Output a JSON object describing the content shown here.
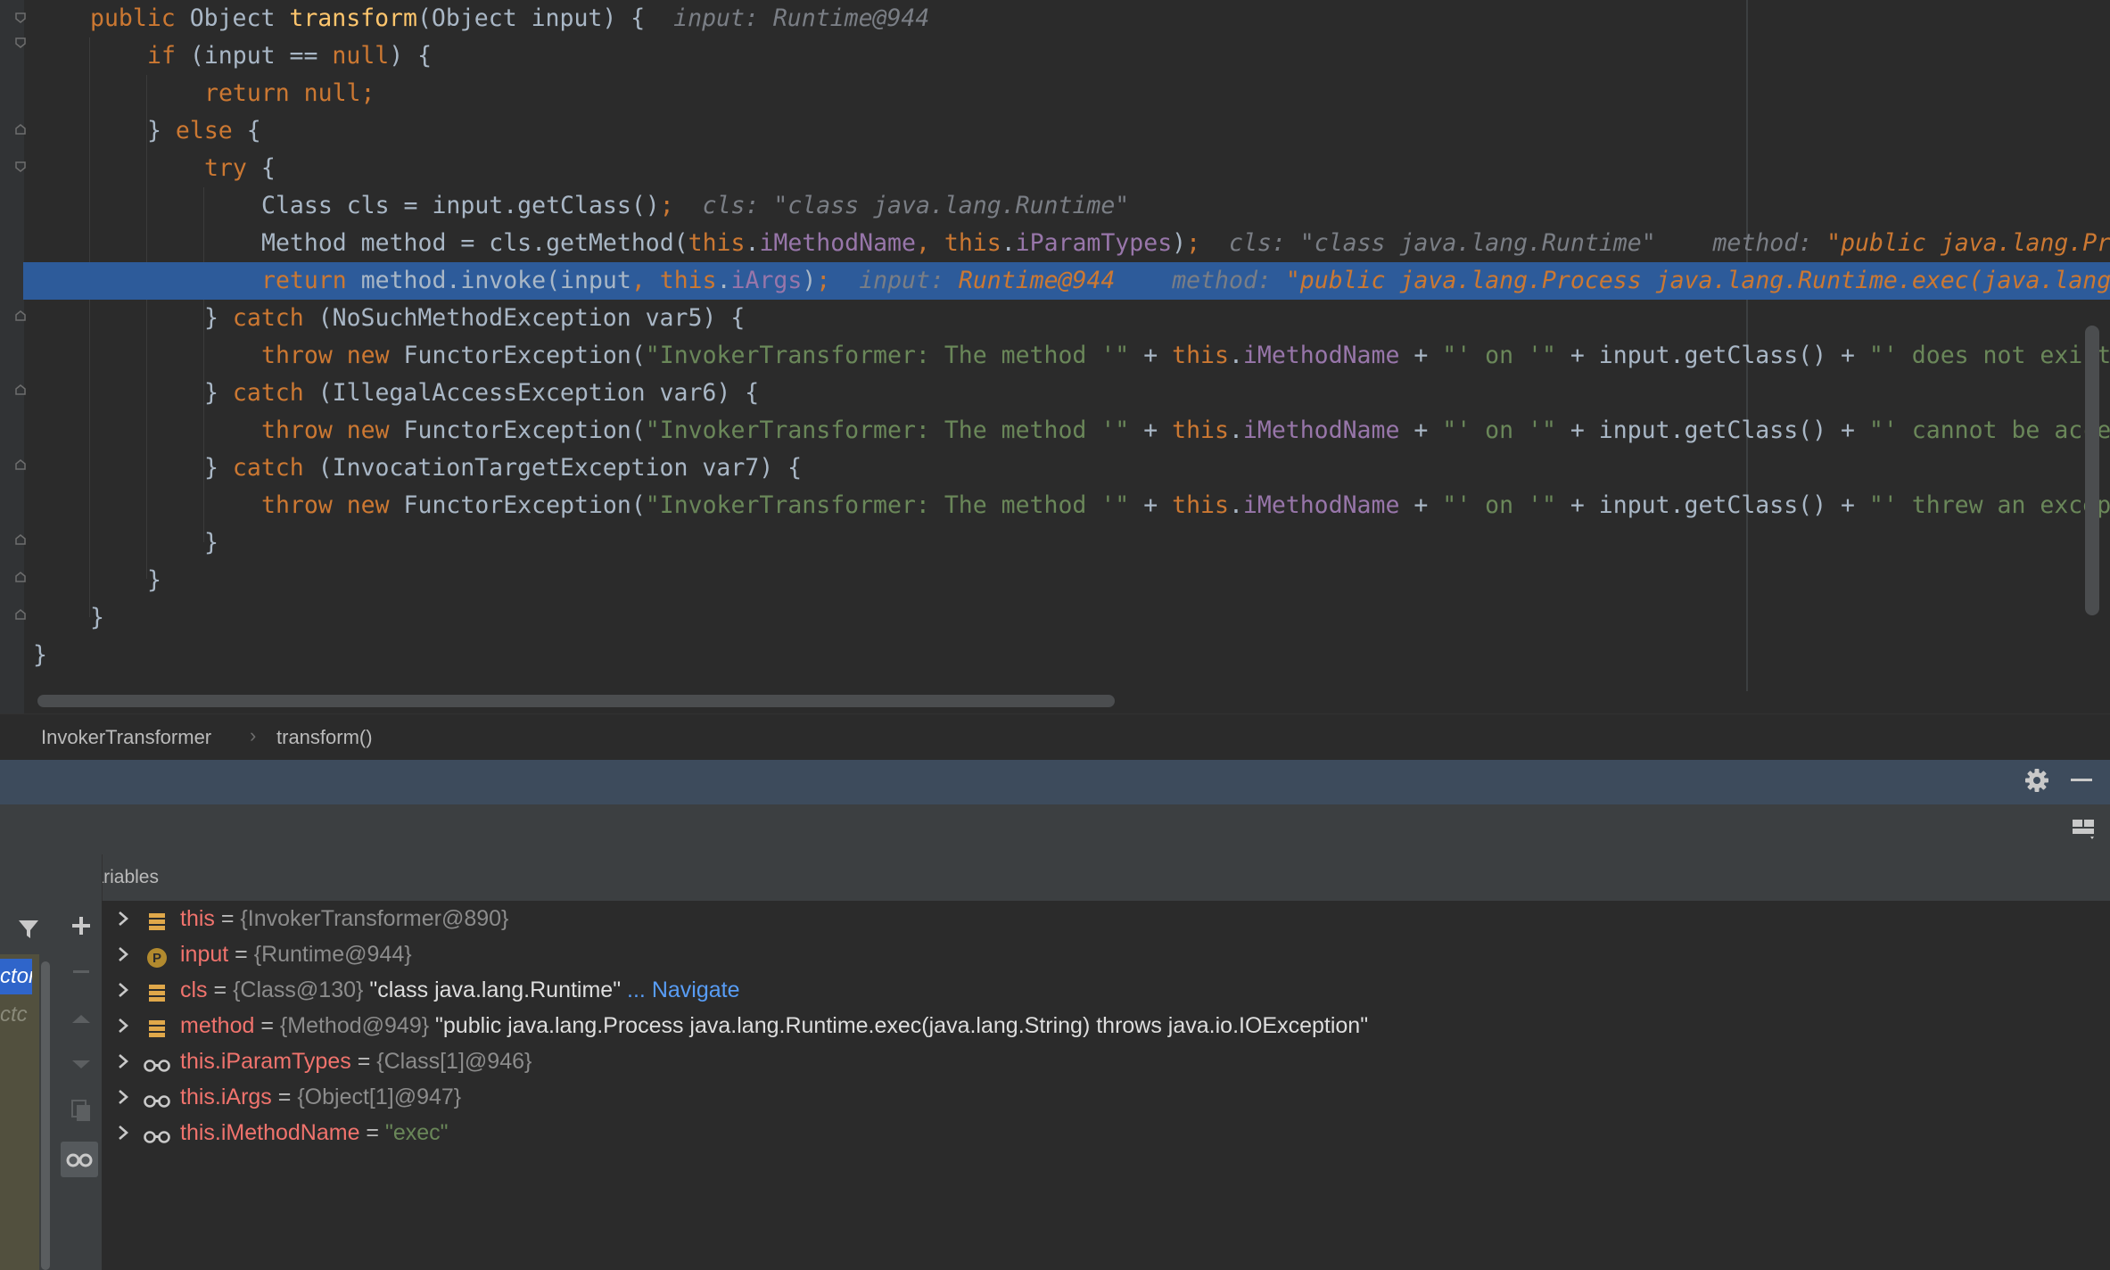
{
  "editor": {
    "lines": [
      {
        "indent": 0,
        "tokens": [
          [
            "kw",
            "public "
          ],
          [
            "plain",
            "Object "
          ],
          [
            "fn",
            "transform"
          ],
          [
            "plain",
            "(Object input) {  "
          ],
          [
            "hint",
            "input: Runtime@944"
          ]
        ]
      },
      {
        "indent": 1,
        "tokens": [
          [
            "kw",
            "if "
          ],
          [
            "plain",
            "(input == "
          ],
          [
            "kw",
            "null"
          ],
          [
            "plain",
            ") {"
          ]
        ]
      },
      {
        "indent": 2,
        "tokens": [
          [
            "kw",
            "return null;"
          ]
        ]
      },
      {
        "indent": 1,
        "tokens": [
          [
            "plain",
            "} "
          ],
          [
            "kw",
            "else "
          ],
          [
            "plain",
            "{"
          ]
        ]
      },
      {
        "indent": 2,
        "tokens": [
          [
            "kw",
            "try "
          ],
          [
            "plain",
            "{"
          ]
        ]
      },
      {
        "indent": 3,
        "tokens": [
          [
            "plain",
            "Class cls = input.getClass()"
          ],
          [
            "kw",
            ";"
          ],
          [
            "plain",
            "  "
          ],
          [
            "hint",
            "cls: \"class java.lang.Runtime\""
          ]
        ]
      },
      {
        "indent": 3,
        "tokens": [
          [
            "plain",
            "Method method = cls.getMethod("
          ],
          [
            "kw",
            "this"
          ],
          [
            "plain",
            "."
          ],
          [
            "fld",
            "iMethodName"
          ],
          [
            "kw",
            ", "
          ],
          [
            "kw",
            "this"
          ],
          [
            "plain",
            "."
          ],
          [
            "fld",
            "iParamTypes"
          ],
          [
            "plain",
            ")"
          ],
          [
            "kw",
            ";"
          ],
          [
            "plain",
            "  "
          ],
          [
            "hint",
            "cls: \"class java.lang.Runtime\"    method: "
          ],
          [
            "hintval",
            "\"public java.lang.Process java.lang.Runtime.exec(java.lang.String)"
          ]
        ]
      },
      {
        "indent": 3,
        "highlight": true,
        "tokens": [
          [
            "kw",
            "return "
          ],
          [
            "plain",
            "method.invoke(input"
          ],
          [
            "kw",
            ", "
          ],
          [
            "kw",
            "this"
          ],
          [
            "plain",
            "."
          ],
          [
            "fld",
            "iArgs"
          ],
          [
            "plain",
            ")"
          ],
          [
            "kw",
            ";"
          ],
          [
            "plain",
            "  "
          ],
          [
            "hint",
            "input: "
          ],
          [
            "hintval",
            "Runtime@944"
          ],
          [
            "hint",
            "    method: "
          ],
          [
            "hintval",
            "\"public java.lang.Process java.lang.Runtime.exec(java.lang.String) throws java.io.IOException\""
          ]
        ]
      },
      {
        "indent": 2,
        "tokens": [
          [
            "plain",
            "} "
          ],
          [
            "kw",
            "catch "
          ],
          [
            "plain",
            "(NoSuchMethodException var5) {"
          ]
        ]
      },
      {
        "indent": 3,
        "tokens": [
          [
            "kw",
            "throw new "
          ],
          [
            "plain",
            "FunctorException("
          ],
          [
            "str",
            "\"InvokerTransformer: The method '\""
          ],
          [
            "plain",
            " + "
          ],
          [
            "kw",
            "this"
          ],
          [
            "plain",
            "."
          ],
          [
            "fld",
            "iMethodName"
          ],
          [
            "plain",
            " + "
          ],
          [
            "str",
            "\"' on '\""
          ],
          [
            "plain",
            " + input.getClass() + "
          ],
          [
            "str",
            "\"' does not exist\""
          ],
          [
            "plain",
            ");"
          ]
        ]
      },
      {
        "indent": 2,
        "tokens": [
          [
            "plain",
            "} "
          ],
          [
            "kw",
            "catch "
          ],
          [
            "plain",
            "(IllegalAccessException var6) {"
          ]
        ]
      },
      {
        "indent": 3,
        "tokens": [
          [
            "kw",
            "throw new "
          ],
          [
            "plain",
            "FunctorException("
          ],
          [
            "str",
            "\"InvokerTransformer: The method '\""
          ],
          [
            "plain",
            " + "
          ],
          [
            "kw",
            "this"
          ],
          [
            "plain",
            "."
          ],
          [
            "fld",
            "iMethodName"
          ],
          [
            "plain",
            " + "
          ],
          [
            "str",
            "\"' on '\""
          ],
          [
            "plain",
            " + input.getClass() + "
          ],
          [
            "str",
            "\"' cannot be accessed\""
          ],
          [
            "plain",
            ");"
          ]
        ]
      },
      {
        "indent": 2,
        "tokens": [
          [
            "plain",
            "} "
          ],
          [
            "kw",
            "catch "
          ],
          [
            "plain",
            "(InvocationTargetException var7) {"
          ]
        ]
      },
      {
        "indent": 3,
        "tokens": [
          [
            "kw",
            "throw new "
          ],
          [
            "plain",
            "FunctorException("
          ],
          [
            "str",
            "\"InvokerTransformer: The method '\""
          ],
          [
            "plain",
            " + "
          ],
          [
            "kw",
            "this"
          ],
          [
            "plain",
            "."
          ],
          [
            "fld",
            "iMethodName"
          ],
          [
            "plain",
            " + "
          ],
          [
            "str",
            "\"' on '\""
          ],
          [
            "plain",
            " + input.getClass() + "
          ],
          [
            "str",
            "\"' threw an exception\""
          ],
          [
            "plain",
            ");"
          ]
        ]
      },
      {
        "indent": 2,
        "tokens": [
          [
            "plain",
            "}"
          ]
        ]
      },
      {
        "indent": 1,
        "tokens": [
          [
            "plain",
            "}"
          ]
        ]
      },
      {
        "indent": 0,
        "tokens": [
          [
            "plain",
            "}"
          ]
        ]
      },
      {
        "indent": -1,
        "tokens": [
          [
            "plain",
            "}"
          ]
        ]
      }
    ]
  },
  "breadcrumb": {
    "class_name": "InvokerTransformer",
    "method_name": "transform()"
  },
  "debug": {
    "panel_title": "Variables",
    "frames": [
      "ctor",
      "ctc"
    ],
    "variables": [
      {
        "icon": "field-icon",
        "name": "this",
        "eq": " = ",
        "type": "{InvokerTransformer@890}",
        "value": "",
        "link": ""
      },
      {
        "icon": "parameter-icon",
        "name": "input",
        "eq": " = ",
        "type": "{Runtime@944}",
        "value": "",
        "link": ""
      },
      {
        "icon": "field-icon",
        "name": "cls",
        "eq": " = ",
        "type": "{Class@130}",
        "value": " \"class java.lang.Runtime\"",
        "link": " ... Navigate"
      },
      {
        "icon": "field-icon",
        "name": "method",
        "eq": " = ",
        "type": "{Method@949}",
        "value": " \"public java.lang.Process java.lang.Runtime.exec(java.lang.String) throws java.io.IOException\"",
        "link": ""
      },
      {
        "icon": "watch-icon",
        "name": "this.iParamTypes",
        "eq": " = ",
        "type": "{Class[1]@946}",
        "value": "",
        "link": ""
      },
      {
        "icon": "watch-icon",
        "name": "this.iArgs",
        "eq": " = ",
        "type": "{Object[1]@947}",
        "value": "",
        "link": ""
      },
      {
        "icon": "watch-icon",
        "name": "this.iMethodName",
        "eq": " = ",
        "type": "",
        "value": "",
        "string": "\"exec\"",
        "link": ""
      }
    ]
  },
  "colors": {
    "editor_bg": "#2b2b2b",
    "highlight_line": "#2d5b9a",
    "keyword": "#cc7832",
    "method_decl": "#ffc66d",
    "field": "#9876aa",
    "string": "#6a8759",
    "debug_header": "#3d4b5c",
    "var_name": "#f0736d",
    "link": "#589df6"
  }
}
